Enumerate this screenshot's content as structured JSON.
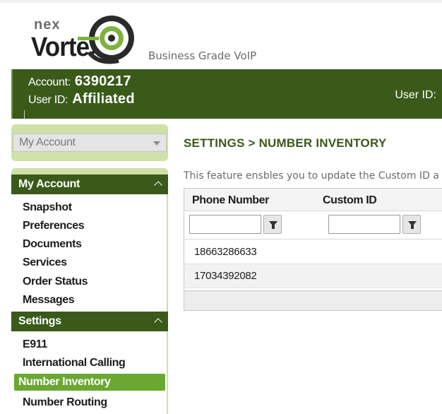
{
  "brand": {
    "logo_top": "nex",
    "logo_main": "Vortex",
    "tagline": "Business Grade VoIP"
  },
  "header": {
    "account_label": "Account:",
    "account_value": "6390217",
    "userid_label": "User ID:",
    "userid_value": "Affiliated",
    "right_label": "User ID:"
  },
  "sidebar": {
    "dropdown_value": "My Account",
    "sections": [
      {
        "title": "My Account",
        "items": [
          "Snapshot",
          "Preferences",
          "Documents",
          "Services",
          "Order Status",
          "Messages"
        ]
      },
      {
        "title": "Settings",
        "items": [
          "E911",
          "International Calling",
          "Number Inventory",
          "Number Routing"
        ]
      }
    ],
    "active_item": "Number Inventory"
  },
  "main": {
    "title": "SETTINGS > NUMBER INVENTORY",
    "description": "This feature ensbles you to update the Custom ID a",
    "columns": [
      "Phone Number",
      "Custom ID"
    ],
    "rows": [
      {
        "phone": "18663286633",
        "custom_id": ""
      },
      {
        "phone": "17034392082",
        "custom_id": ""
      }
    ]
  },
  "colors": {
    "brand_dark_green": "#3a5a1a",
    "active_green": "#6aa831",
    "light_green": "#cfe0a8"
  }
}
